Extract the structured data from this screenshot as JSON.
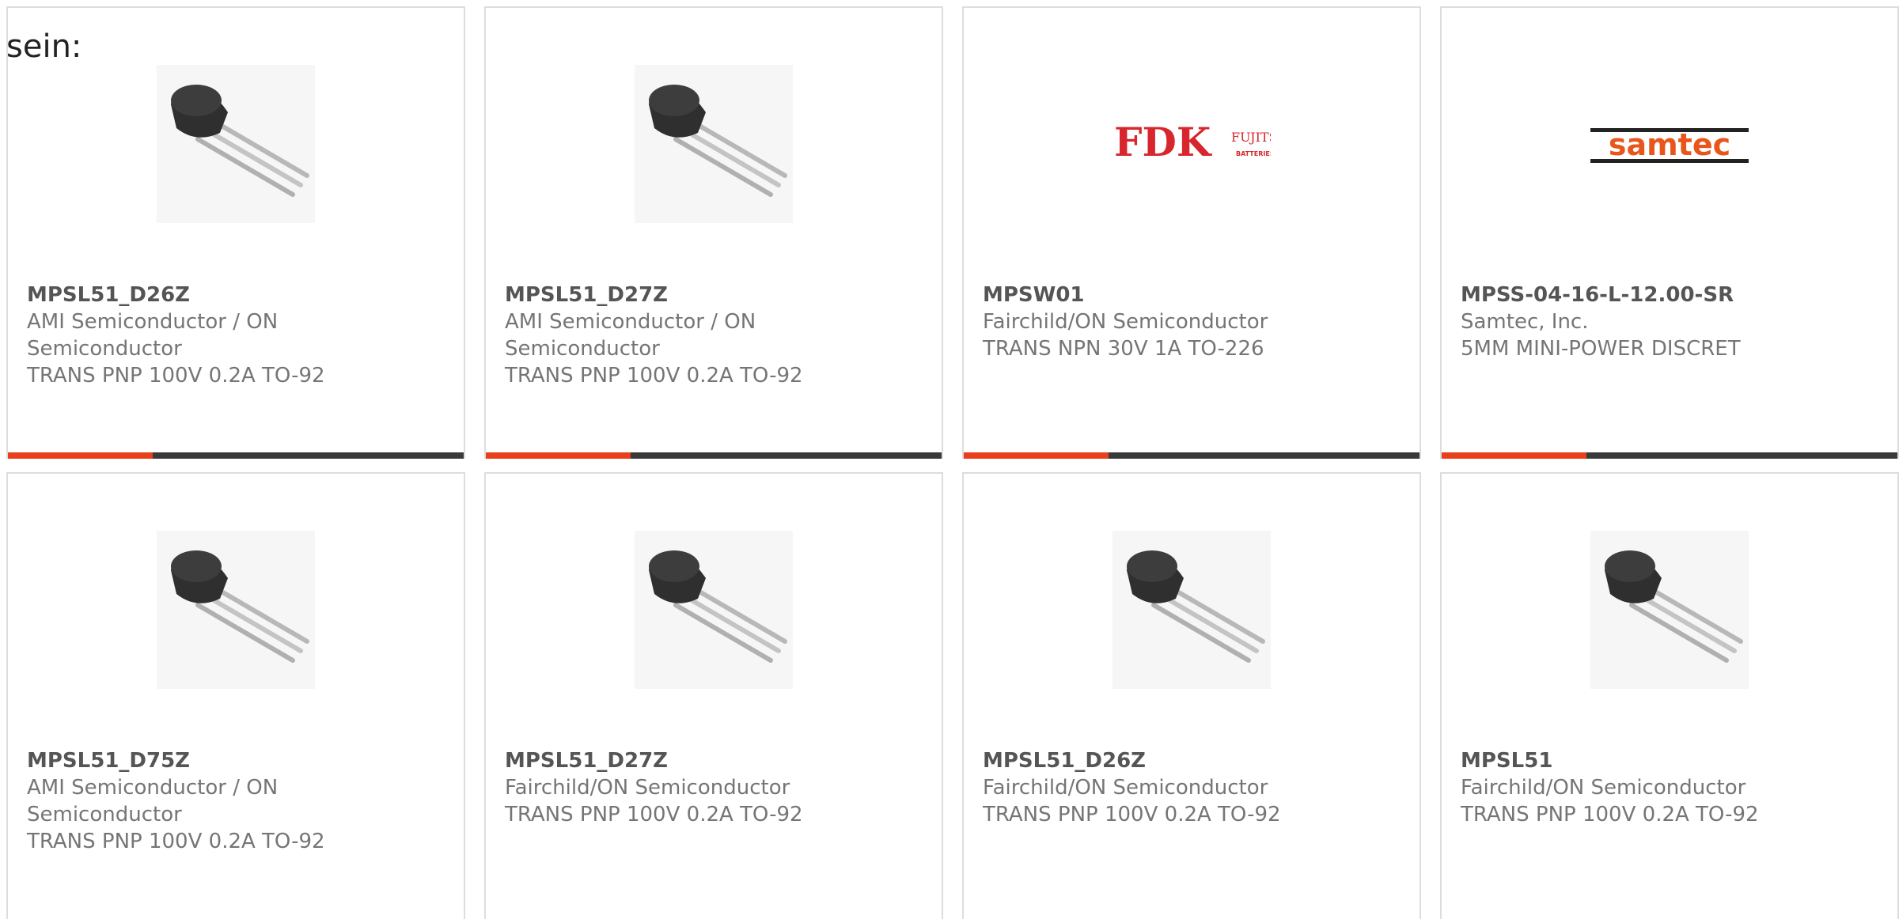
{
  "intro_text": "sein:",
  "colors": {
    "accent": "#e8401c",
    "bar": "#3a3a3a",
    "text": "#757575"
  },
  "products": [
    {
      "part": "MPSL51_D26Z",
      "manufacturer": "AMI Semiconductor / ON Semiconductor",
      "description": "TRANS PNP 100V 0.2A TO-92",
      "image": "transistor-to92"
    },
    {
      "part": "MPSL51_D27Z",
      "manufacturer": "AMI Semiconductor / ON Semiconductor",
      "description": "TRANS PNP 100V 0.2A TO-92",
      "image": "transistor-to92"
    },
    {
      "part": "MPSW01",
      "manufacturer": "Fairchild/ON Semiconductor",
      "description": "TRANS NPN 30V 1A TO-226",
      "image": "fdk-logo",
      "logo": {
        "main": "FDK",
        "sub": "FUJITSU",
        "tag": "BATTERIES"
      }
    },
    {
      "part": "MPSS-04-16-L-12.00-SR",
      "manufacturer": "Samtec, Inc.",
      "description": "5MM MINI-POWER DISCRET",
      "image": "samtec-logo",
      "logo": {
        "main": "samtec"
      }
    },
    {
      "part": "MPSL51_D75Z",
      "manufacturer": "AMI Semiconductor / ON Semiconductor",
      "description": "TRANS PNP 100V 0.2A TO-92",
      "image": "transistor-to92"
    },
    {
      "part": "MPSL51_D27Z",
      "manufacturer": "Fairchild/ON Semiconductor",
      "description": "TRANS PNP 100V 0.2A TO-92",
      "image": "transistor-to92"
    },
    {
      "part": "MPSL51_D26Z",
      "manufacturer": "Fairchild/ON Semiconductor",
      "description": "TRANS PNP 100V 0.2A TO-92",
      "image": "transistor-to92"
    },
    {
      "part": "MPSL51",
      "manufacturer": "Fairchild/ON Semiconductor",
      "description": "TRANS PNP 100V 0.2A TO-92",
      "image": "transistor-to92"
    }
  ]
}
